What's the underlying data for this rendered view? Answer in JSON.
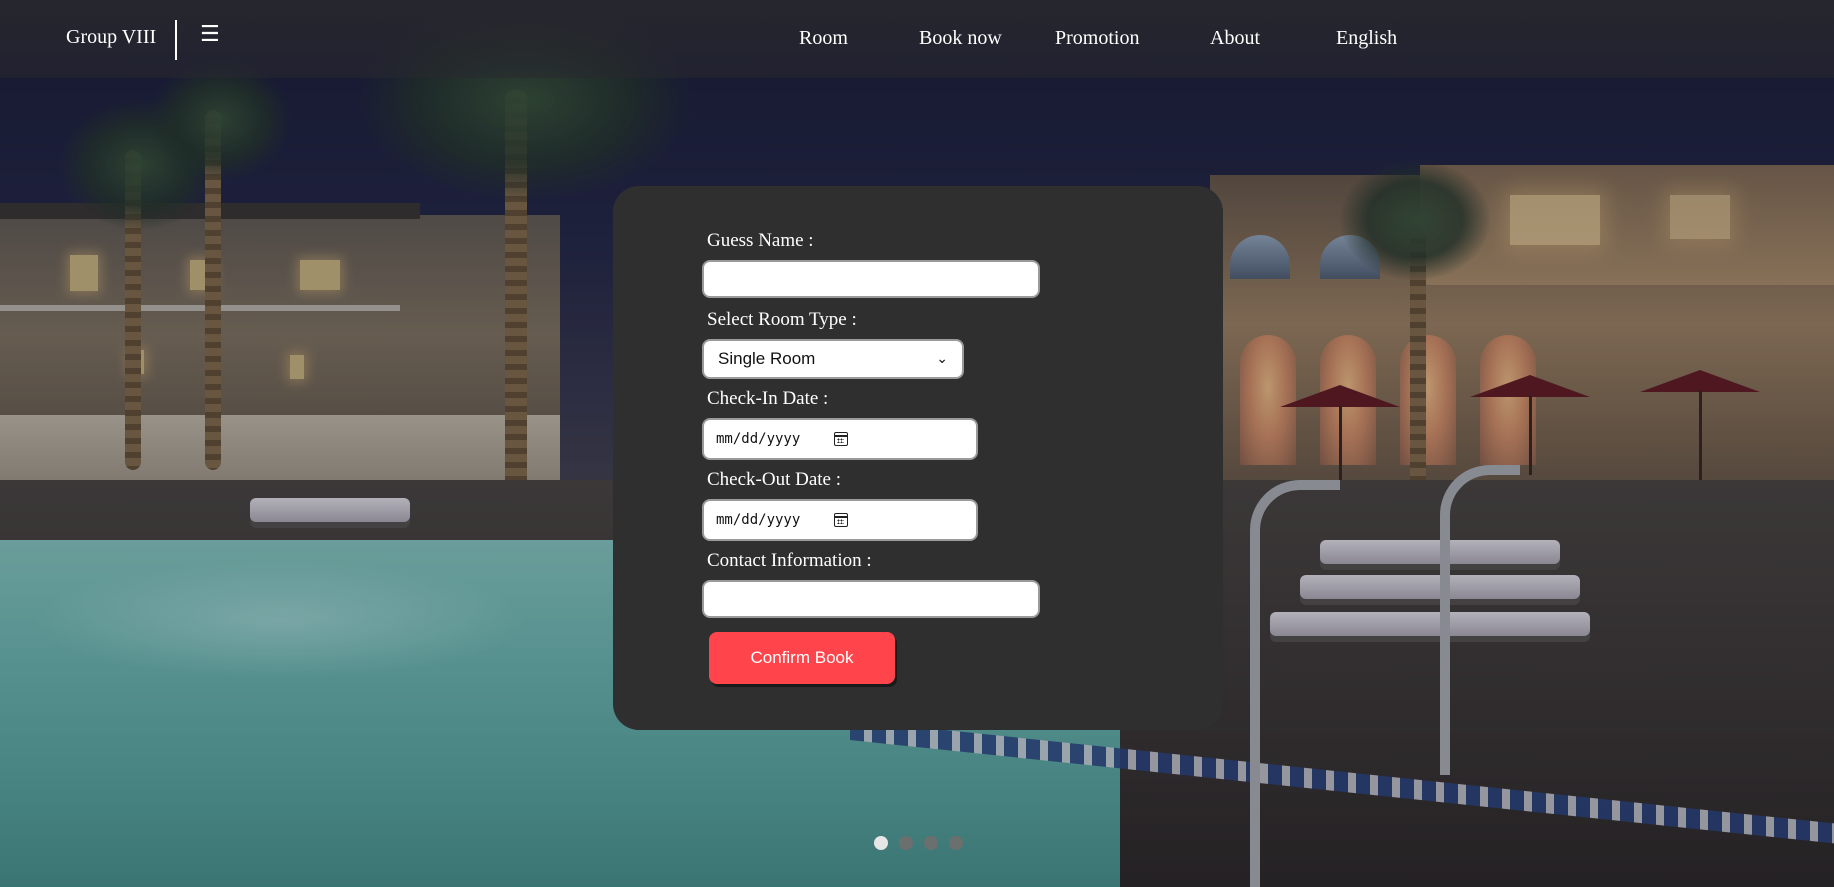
{
  "navbar": {
    "brand": "Group VIII",
    "menu_icon": "hamburger-menu-icon",
    "links": [
      "Room",
      "Book now",
      "Promotion",
      "About",
      "English"
    ]
  },
  "booking_form": {
    "guest_name_label": "Guess Name :",
    "guest_name_value": "",
    "room_type_label": "Select Room Type :",
    "room_type_selected": "Single Room",
    "check_in_label": "Check-In Date :",
    "check_in_placeholder": "mm/dd/yyyy",
    "check_out_label": "Check-Out Date :",
    "check_out_placeholder": "mm/dd/yyyy",
    "contact_label": "Contact Information :",
    "contact_value": "",
    "confirm_label": "Confirm Book",
    "confirm_color": "#ff454b",
    "card_color": "#2f2f2f"
  },
  "carousel": {
    "slide_count": 4,
    "active_index": 0
  }
}
